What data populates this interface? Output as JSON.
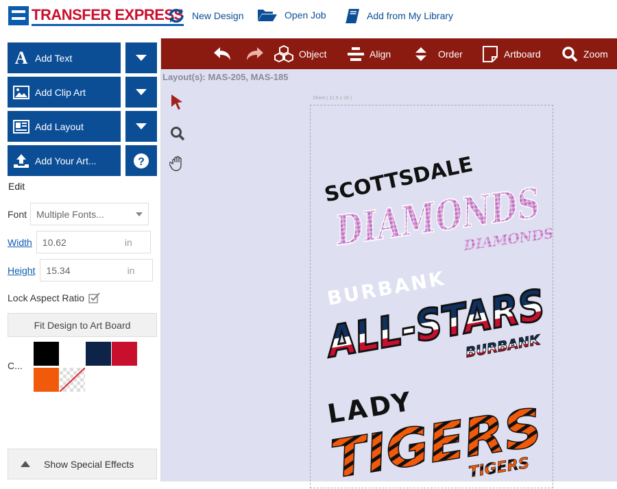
{
  "brand": {
    "name": "TRANSFER EXPRESS"
  },
  "topnav": {
    "new_design": "New Design",
    "open_job": "Open Job",
    "add_library": "Add from My Library"
  },
  "sidebar": {
    "add_text": "Add Text",
    "add_clipart": "Add Clip Art",
    "add_layout": "Add Layout",
    "add_art": "Add Your Art...",
    "edit_label": "Edit",
    "font_label": "Font",
    "font_value": "Multiple Fonts...",
    "width_label": "Width",
    "width_value": "10.62",
    "width_unit": "in",
    "height_label": "Height",
    "height_value": "15.34",
    "height_unit": "in",
    "lock_label": "Lock Aspect Ratio",
    "fit_label": "Fit Design to Art Board",
    "colors_label": "C...",
    "colors": [
      "#000000",
      "#ffffff",
      "#0d2347",
      "#c8102e",
      "#f15a0a",
      "transparent"
    ],
    "special_effects": "Show Special Effects"
  },
  "toolbar": {
    "object": "Object",
    "align": "Align",
    "order": "Order",
    "artboard": "Artboard",
    "zoom": "Zoom"
  },
  "canvas": {
    "layouts": "Layout(s): MAS-205, MAS-185",
    "sheet_label": "Sheet ( 11.5 x 18 )",
    "design1": {
      "top": "SCOTTSDALE",
      "main": "DIAMONDS",
      "sub": "DIAMONDS"
    },
    "design2": {
      "top": "BURBANK",
      "main": "ALL-STARS",
      "sub": "BURBANK"
    },
    "design3": {
      "top": "LADY",
      "main": "TIGERS",
      "sub": "TIGERS"
    }
  },
  "colors": {
    "primary": "#0b4e96",
    "toolbar": "#8b1a10",
    "canvas": "#dedff1",
    "brand_red": "#c8102e"
  }
}
